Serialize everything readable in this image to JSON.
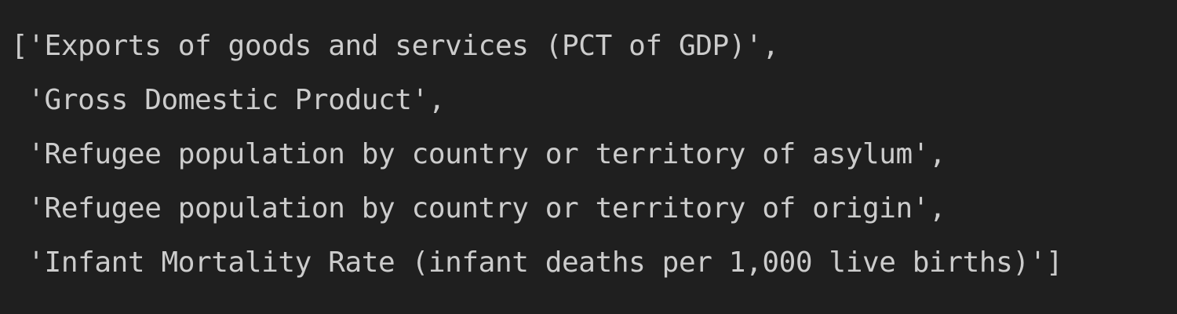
{
  "output": {
    "lines": [
      "['Exports of goods and services (PCT of GDP)',",
      " 'Gross Domestic Product',",
      " 'Refugee population by country or territory of asylum',",
      " 'Refugee population by country or territory of origin',",
      " 'Infant Mortality Rate (infant deaths per 1,000 live births)']"
    ]
  },
  "colors": {
    "background": "#1f1f1f",
    "text": "#cccccc"
  }
}
